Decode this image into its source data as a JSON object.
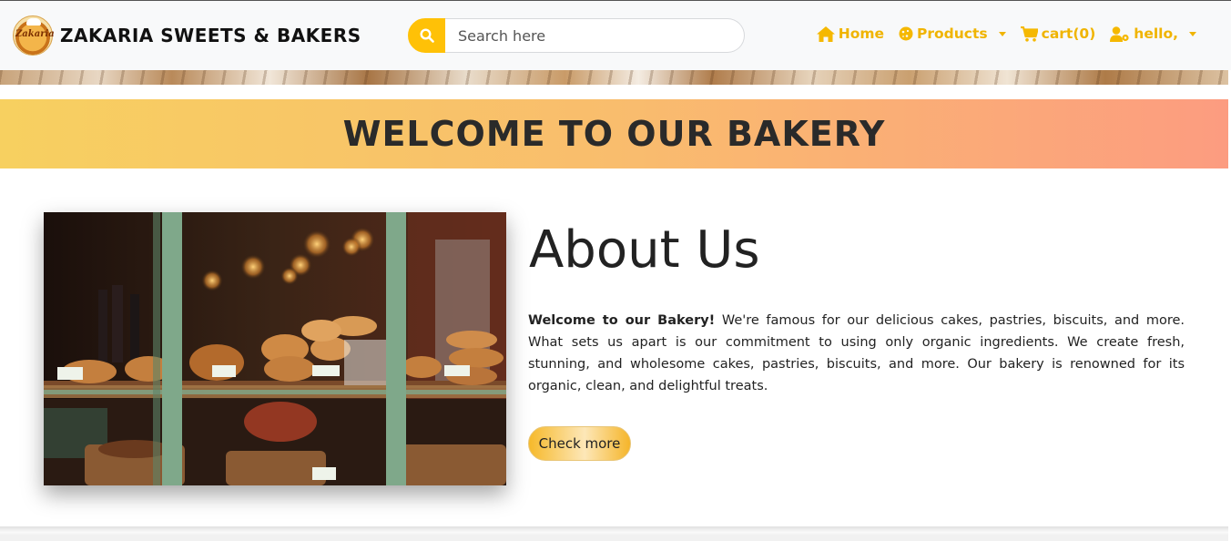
{
  "navbar": {
    "brand_name": "ZAKARIA SWEETS & BAKERS",
    "logo_text": "Zakaria",
    "search": {
      "placeholder": "Search here"
    },
    "items": [
      {
        "label": "Home",
        "icon": "home-icon"
      },
      {
        "label": "Products",
        "icon": "cookie-icon"
      },
      {
        "label": "cart(0)",
        "icon": "cart-icon"
      },
      {
        "label": "hello,",
        "icon": "user-gear-icon"
      }
    ]
  },
  "banner": {
    "title": "WELCOME TO OUR BAKERY"
  },
  "about": {
    "title": "About Us",
    "intro_bold": "Welcome to our Bakery!",
    "body": " We're famous for our delicious cakes, pastries, biscuits, and more. What sets us apart is our commitment to using only organic ingredients. We create fresh, stunning, and wholesome cakes, pastries, biscuits, and more. Our bakery is renowned for its organic, clean, and delightful treats.",
    "button_label": "Check more"
  },
  "colors": {
    "accent": "#ffc107",
    "nav_text": "#f0b400",
    "banner_start": "#f7d060",
    "banner_end": "#fc9c80"
  }
}
